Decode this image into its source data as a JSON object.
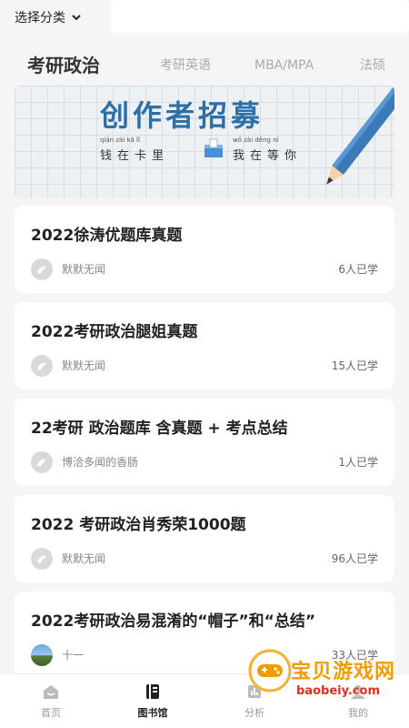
{
  "header": {
    "category_label": "选择分类",
    "search_placeholder": ""
  },
  "tabs": [
    {
      "label": "考研政治",
      "active": true
    },
    {
      "label": "考研英语",
      "active": false
    },
    {
      "label": "MBA/MPA",
      "active": false
    },
    {
      "label": "法硕",
      "active": false
    }
  ],
  "banner": {
    "title": "创作者招募",
    "subtitle_left": "钱在卡里",
    "subtitle_right": "我在等你",
    "pinyin_left": "qián zài kǎ lǐ",
    "pinyin_right": "wǒ zài děng nǐ"
  },
  "cards": [
    {
      "title": "2022徐涛优题库真题",
      "author": "默默无闻",
      "learners": "6人已学"
    },
    {
      "title": "2022考研政治腿姐真题",
      "author": "默默无闻",
      "learners": "15人已学"
    },
    {
      "title": "22考研 政治题库 含真题 + 考点总结",
      "author": "博洽多闻的香肠",
      "learners": "1人已学"
    },
    {
      "title": "2022 考研政治肖秀荣1000题",
      "author": "默默无闻",
      "learners": "96人已学"
    },
    {
      "title": "2022考研政治易混淆的“帽子”和“总结”",
      "author": "十一",
      "learners": "33人已学"
    }
  ],
  "tabbar": [
    {
      "label": "首页",
      "icon": "home-icon",
      "active": false
    },
    {
      "label": "图书馆",
      "icon": "library-icon",
      "active": true
    },
    {
      "label": "分析",
      "icon": "analysis-icon",
      "active": false
    },
    {
      "label": "我的",
      "icon": "profile-icon",
      "active": false
    }
  ],
  "watermark": {
    "text": "宝贝游戏网",
    "url": "baobeiy.com"
  },
  "colors": {
    "banner_title": "#2f6fa8",
    "watermark_text": "#f39c00",
    "watermark_url": "#e0301e"
  }
}
